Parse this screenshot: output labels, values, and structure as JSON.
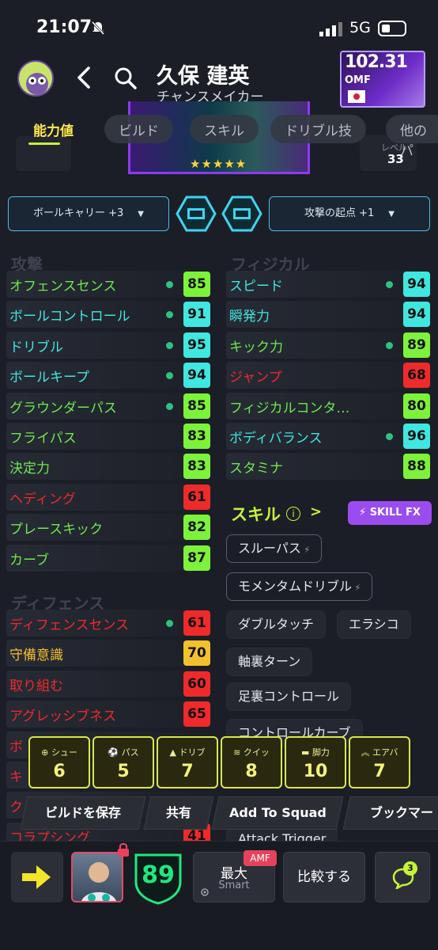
{
  "status": {
    "time": "21:07",
    "network": "5G"
  },
  "header": {
    "name": "久保 建英",
    "role": "チャンスメイカー"
  },
  "card": {
    "rating": "102.31",
    "position": "OMF",
    "level_label": "レベル",
    "level": "33"
  },
  "tabs": [
    "能力値",
    "ビルド",
    "スキル",
    "ドリブル技",
    "他のパ"
  ],
  "selectors": {
    "left": "ボールキャリー +3",
    "right": "攻撃の起点 +1"
  },
  "colors": {
    "green": "#7cf23a",
    "lime": "#c6f23a",
    "cyan": "#3fe7e0",
    "yellow": "#f2c12c",
    "red": "#ef2a2a"
  },
  "attack": {
    "title": "攻撃",
    "stats": [
      {
        "label": "オフェンスセンス",
        "value": "85",
        "dot": true,
        "label_color": "#6de84f",
        "value_color": "#7cf23a"
      },
      {
        "label": "ボールコントロール",
        "value": "91",
        "dot": true,
        "label_color": "#3fe7e0",
        "value_color": "#3fe7e0"
      },
      {
        "label": "ドリブル",
        "value": "95",
        "dot": true,
        "label_color": "#3fe7e0",
        "value_color": "#3fe7e0"
      },
      {
        "label": "ボールキープ",
        "value": "94",
        "dot": true,
        "label_color": "#3fe7e0",
        "value_color": "#3fe7e0"
      },
      {
        "label": "グラウンダーパス",
        "value": "85",
        "dot": true,
        "label_color": "#6de84f",
        "value_color": "#7cf23a"
      },
      {
        "label": "フライパス",
        "value": "83",
        "dot": false,
        "label_color": "#6de84f",
        "value_color": "#7cf23a"
      },
      {
        "label": "決定力",
        "value": "83",
        "dot": false,
        "label_color": "#6de84f",
        "value_color": "#7cf23a"
      },
      {
        "label": "ヘディング",
        "value": "61",
        "dot": false,
        "label_color": "#ef2a2a",
        "value_color": "#ef2a2a"
      },
      {
        "label": "プレースキック",
        "value": "82",
        "dot": false,
        "label_color": "#6de84f",
        "value_color": "#7cf23a"
      },
      {
        "label": "カーブ",
        "value": "87",
        "dot": false,
        "label_color": "#6de84f",
        "value_color": "#7cf23a"
      }
    ]
  },
  "physical": {
    "title": "フィジカル",
    "stats": [
      {
        "label": "スピード",
        "value": "94",
        "dot": true,
        "label_color": "#3fe7e0",
        "value_color": "#3fe7e0"
      },
      {
        "label": "瞬発力",
        "value": "94",
        "dot": false,
        "label_color": "#3fe7e0",
        "value_color": "#3fe7e0"
      },
      {
        "label": "キック力",
        "value": "89",
        "dot": true,
        "label_color": "#6de84f",
        "value_color": "#7cf23a"
      },
      {
        "label": "ジャンプ",
        "value": "68",
        "dot": false,
        "label_color": "#ef2a2a",
        "value_color": "#ef2a2a"
      },
      {
        "label": "フィジカルコンタ…",
        "value": "80",
        "dot": false,
        "label_color": "#6de84f",
        "value_color": "#7cf23a"
      },
      {
        "label": "ボディバランス",
        "value": "96",
        "dot": true,
        "label_color": "#3fe7e0",
        "value_color": "#3fe7e0"
      },
      {
        "label": "スタミナ",
        "value": "88",
        "dot": false,
        "label_color": "#6de84f",
        "value_color": "#7cf23a"
      }
    ]
  },
  "defense": {
    "title": "ディフェンス",
    "stats": [
      {
        "label": "ディフェンスセンス",
        "value": "61",
        "dot": true,
        "label_color": "#ef2a2a",
        "value_color": "#ef2a2a"
      },
      {
        "label": "守備意識",
        "value": "70",
        "dot": false,
        "label_color": "#f2c12c",
        "value_color": "#f2c12c"
      },
      {
        "label": "取り組む",
        "value": "60",
        "dot": false,
        "label_color": "#ef2a2a",
        "value_color": "#ef2a2a"
      },
      {
        "label": "アグレッシブネス",
        "value": "65",
        "dot": false,
        "label_color": "#ef2a2a",
        "value_color": "#ef2a2a"
      },
      {
        "label": "ボ",
        "value": "",
        "dot": false,
        "label_color": "#ef2a2a",
        "value_color": "#ef2a2a"
      },
      {
        "label": "キ",
        "value": "",
        "dot": false,
        "label_color": "#ef2a2a",
        "value_color": "#ef2a2a"
      },
      {
        "label": "ク",
        "value": "",
        "dot": false,
        "label_color": "#ef2a2a",
        "value_color": "#ef2a2a"
      },
      {
        "label": "コラプシング",
        "value": "41",
        "dot": false,
        "label_color": "#ef2a2a",
        "value_color": "#ef2a2a"
      }
    ]
  },
  "skills": {
    "title": "スキル",
    "fx_label": "SKILL FX",
    "items": [
      "スルーパス",
      "モメンタムドリブル",
      "ダブルタッチ",
      "エラシコ",
      "軸裏ターン",
      "足裏コントロール",
      "コントロールカーブ",
      "Attack Trigger"
    ]
  },
  "build_stats": [
    {
      "label": "シュー",
      "value": "6"
    },
    {
      "label": "パス",
      "value": "5"
    },
    {
      "label": "ドリブ",
      "value": "7"
    },
    {
      "label": "クイッ",
      "value": "8"
    },
    {
      "label": "脚力",
      "value": "10"
    },
    {
      "label": "エアバ",
      "value": "7"
    }
  ],
  "actions": [
    "ビルドを保存",
    "共有",
    "Add To Squad",
    "ブックマー"
  ],
  "bottom": {
    "ovr": "89",
    "max_label": "最大",
    "max_sub": "Smart",
    "max_badge": "AMF",
    "compare": "比較する",
    "chat_count": "3"
  }
}
